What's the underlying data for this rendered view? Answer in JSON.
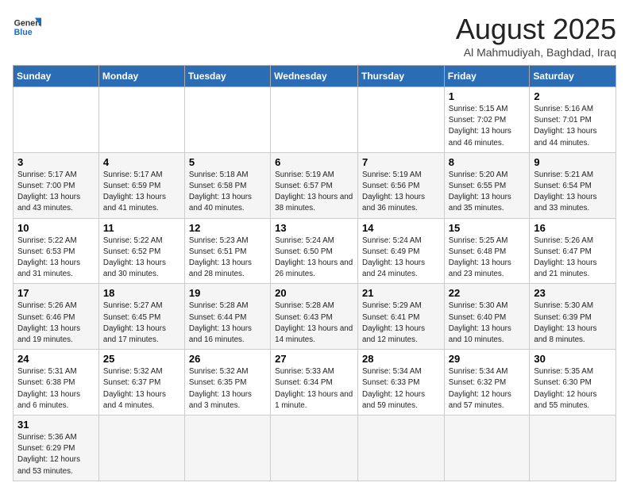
{
  "logo": {
    "line1": "General",
    "line2": "Blue"
  },
  "title": "August 2025",
  "subtitle": "Al Mahmudiyah, Baghdad, Iraq",
  "weekdays": [
    "Sunday",
    "Monday",
    "Tuesday",
    "Wednesday",
    "Thursday",
    "Friday",
    "Saturday"
  ],
  "weeks": [
    [
      {
        "day": "",
        "info": ""
      },
      {
        "day": "",
        "info": ""
      },
      {
        "day": "",
        "info": ""
      },
      {
        "day": "",
        "info": ""
      },
      {
        "day": "",
        "info": ""
      },
      {
        "day": "1",
        "info": "Sunrise: 5:15 AM\nSunset: 7:02 PM\nDaylight: 13 hours and 46 minutes."
      },
      {
        "day": "2",
        "info": "Sunrise: 5:16 AM\nSunset: 7:01 PM\nDaylight: 13 hours and 44 minutes."
      }
    ],
    [
      {
        "day": "3",
        "info": "Sunrise: 5:17 AM\nSunset: 7:00 PM\nDaylight: 13 hours and 43 minutes."
      },
      {
        "day": "4",
        "info": "Sunrise: 5:17 AM\nSunset: 6:59 PM\nDaylight: 13 hours and 41 minutes."
      },
      {
        "day": "5",
        "info": "Sunrise: 5:18 AM\nSunset: 6:58 PM\nDaylight: 13 hours and 40 minutes."
      },
      {
        "day": "6",
        "info": "Sunrise: 5:19 AM\nSunset: 6:57 PM\nDaylight: 13 hours and 38 minutes."
      },
      {
        "day": "7",
        "info": "Sunrise: 5:19 AM\nSunset: 6:56 PM\nDaylight: 13 hours and 36 minutes."
      },
      {
        "day": "8",
        "info": "Sunrise: 5:20 AM\nSunset: 6:55 PM\nDaylight: 13 hours and 35 minutes."
      },
      {
        "day": "9",
        "info": "Sunrise: 5:21 AM\nSunset: 6:54 PM\nDaylight: 13 hours and 33 minutes."
      }
    ],
    [
      {
        "day": "10",
        "info": "Sunrise: 5:22 AM\nSunset: 6:53 PM\nDaylight: 13 hours and 31 minutes."
      },
      {
        "day": "11",
        "info": "Sunrise: 5:22 AM\nSunset: 6:52 PM\nDaylight: 13 hours and 30 minutes."
      },
      {
        "day": "12",
        "info": "Sunrise: 5:23 AM\nSunset: 6:51 PM\nDaylight: 13 hours and 28 minutes."
      },
      {
        "day": "13",
        "info": "Sunrise: 5:24 AM\nSunset: 6:50 PM\nDaylight: 13 hours and 26 minutes."
      },
      {
        "day": "14",
        "info": "Sunrise: 5:24 AM\nSunset: 6:49 PM\nDaylight: 13 hours and 24 minutes."
      },
      {
        "day": "15",
        "info": "Sunrise: 5:25 AM\nSunset: 6:48 PM\nDaylight: 13 hours and 23 minutes."
      },
      {
        "day": "16",
        "info": "Sunrise: 5:26 AM\nSunset: 6:47 PM\nDaylight: 13 hours and 21 minutes."
      }
    ],
    [
      {
        "day": "17",
        "info": "Sunrise: 5:26 AM\nSunset: 6:46 PM\nDaylight: 13 hours and 19 minutes."
      },
      {
        "day": "18",
        "info": "Sunrise: 5:27 AM\nSunset: 6:45 PM\nDaylight: 13 hours and 17 minutes."
      },
      {
        "day": "19",
        "info": "Sunrise: 5:28 AM\nSunset: 6:44 PM\nDaylight: 13 hours and 16 minutes."
      },
      {
        "day": "20",
        "info": "Sunrise: 5:28 AM\nSunset: 6:43 PM\nDaylight: 13 hours and 14 minutes."
      },
      {
        "day": "21",
        "info": "Sunrise: 5:29 AM\nSunset: 6:41 PM\nDaylight: 13 hours and 12 minutes."
      },
      {
        "day": "22",
        "info": "Sunrise: 5:30 AM\nSunset: 6:40 PM\nDaylight: 13 hours and 10 minutes."
      },
      {
        "day": "23",
        "info": "Sunrise: 5:30 AM\nSunset: 6:39 PM\nDaylight: 13 hours and 8 minutes."
      }
    ],
    [
      {
        "day": "24",
        "info": "Sunrise: 5:31 AM\nSunset: 6:38 PM\nDaylight: 13 hours and 6 minutes."
      },
      {
        "day": "25",
        "info": "Sunrise: 5:32 AM\nSunset: 6:37 PM\nDaylight: 13 hours and 4 minutes."
      },
      {
        "day": "26",
        "info": "Sunrise: 5:32 AM\nSunset: 6:35 PM\nDaylight: 13 hours and 3 minutes."
      },
      {
        "day": "27",
        "info": "Sunrise: 5:33 AM\nSunset: 6:34 PM\nDaylight: 13 hours and 1 minute."
      },
      {
        "day": "28",
        "info": "Sunrise: 5:34 AM\nSunset: 6:33 PM\nDaylight: 12 hours and 59 minutes."
      },
      {
        "day": "29",
        "info": "Sunrise: 5:34 AM\nSunset: 6:32 PM\nDaylight: 12 hours and 57 minutes."
      },
      {
        "day": "30",
        "info": "Sunrise: 5:35 AM\nSunset: 6:30 PM\nDaylight: 12 hours and 55 minutes."
      }
    ],
    [
      {
        "day": "31",
        "info": "Sunrise: 5:36 AM\nSunset: 6:29 PM\nDaylight: 12 hours and 53 minutes."
      },
      {
        "day": "",
        "info": ""
      },
      {
        "day": "",
        "info": ""
      },
      {
        "day": "",
        "info": ""
      },
      {
        "day": "",
        "info": ""
      },
      {
        "day": "",
        "info": ""
      },
      {
        "day": "",
        "info": ""
      }
    ]
  ]
}
